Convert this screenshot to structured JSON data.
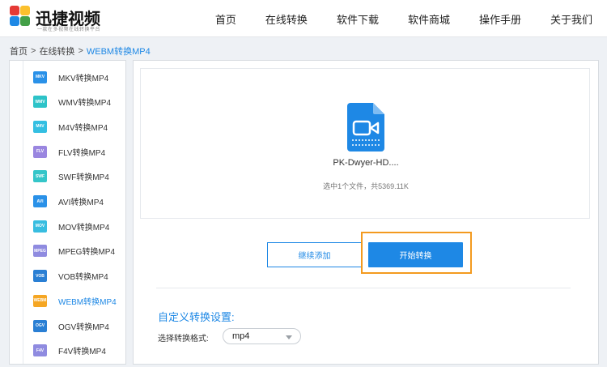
{
  "header": {
    "logo_title": "迅捷视频",
    "logo_subtitle": "一款在多视频在线转换平台",
    "nav": [
      "首页",
      "在线转换",
      "软件下载",
      "软件商城",
      "操作手册",
      "关于我们"
    ]
  },
  "breadcrumb": {
    "home": "首页",
    "section": "在线转换",
    "current": "WEBM转换MP4",
    "separator": ">"
  },
  "sidebar": {
    "items": [
      {
        "badge": "MKV",
        "label": "MKV转换MP4",
        "color": "#2a91e8"
      },
      {
        "badge": "WMV",
        "label": "WMV转换MP4",
        "color": "#2dc3c8"
      },
      {
        "badge": "M4V",
        "label": "M4V转换MP4",
        "color": "#34bfe2"
      },
      {
        "badge": "FLV",
        "label": "FLV转换MP4",
        "color": "#9a86e0"
      },
      {
        "badge": "SWF",
        "label": "SWF转换MP4",
        "color": "#35c6c9"
      },
      {
        "badge": "AVI",
        "label": "AVI转换MP4",
        "color": "#2a91e8"
      },
      {
        "badge": "MOV",
        "label": "MOV转换MP4",
        "color": "#38bde0"
      },
      {
        "badge": "MPEG",
        "label": "MPEG转换MP4",
        "color": "#8f8be0"
      },
      {
        "badge": "VOB",
        "label": "VOB转换MP4",
        "color": "#2a7fd4"
      },
      {
        "badge": "WEBM",
        "label": "WEBM转换MP4",
        "color": "#f5a623"
      },
      {
        "badge": "OGV",
        "label": "OGV转换MP4",
        "color": "#2a7fd4"
      },
      {
        "badge": "F4V",
        "label": "F4V转换MP4",
        "color": "#8f8be0"
      }
    ],
    "active_index": 9
  },
  "upload": {
    "file_name": "PK-Dwyer-HD....",
    "file_info": "选中1个文件，共5369.11K",
    "icon": "video-file-icon"
  },
  "actions": {
    "add_label": "继续添加",
    "start_label": "开始转换"
  },
  "settings": {
    "title": "自定义转换设置:",
    "format_label": "选择转换格式:",
    "format_value": "mp4"
  },
  "colors": {
    "accent": "#1e88e5",
    "highlight": "#f39a1f"
  }
}
